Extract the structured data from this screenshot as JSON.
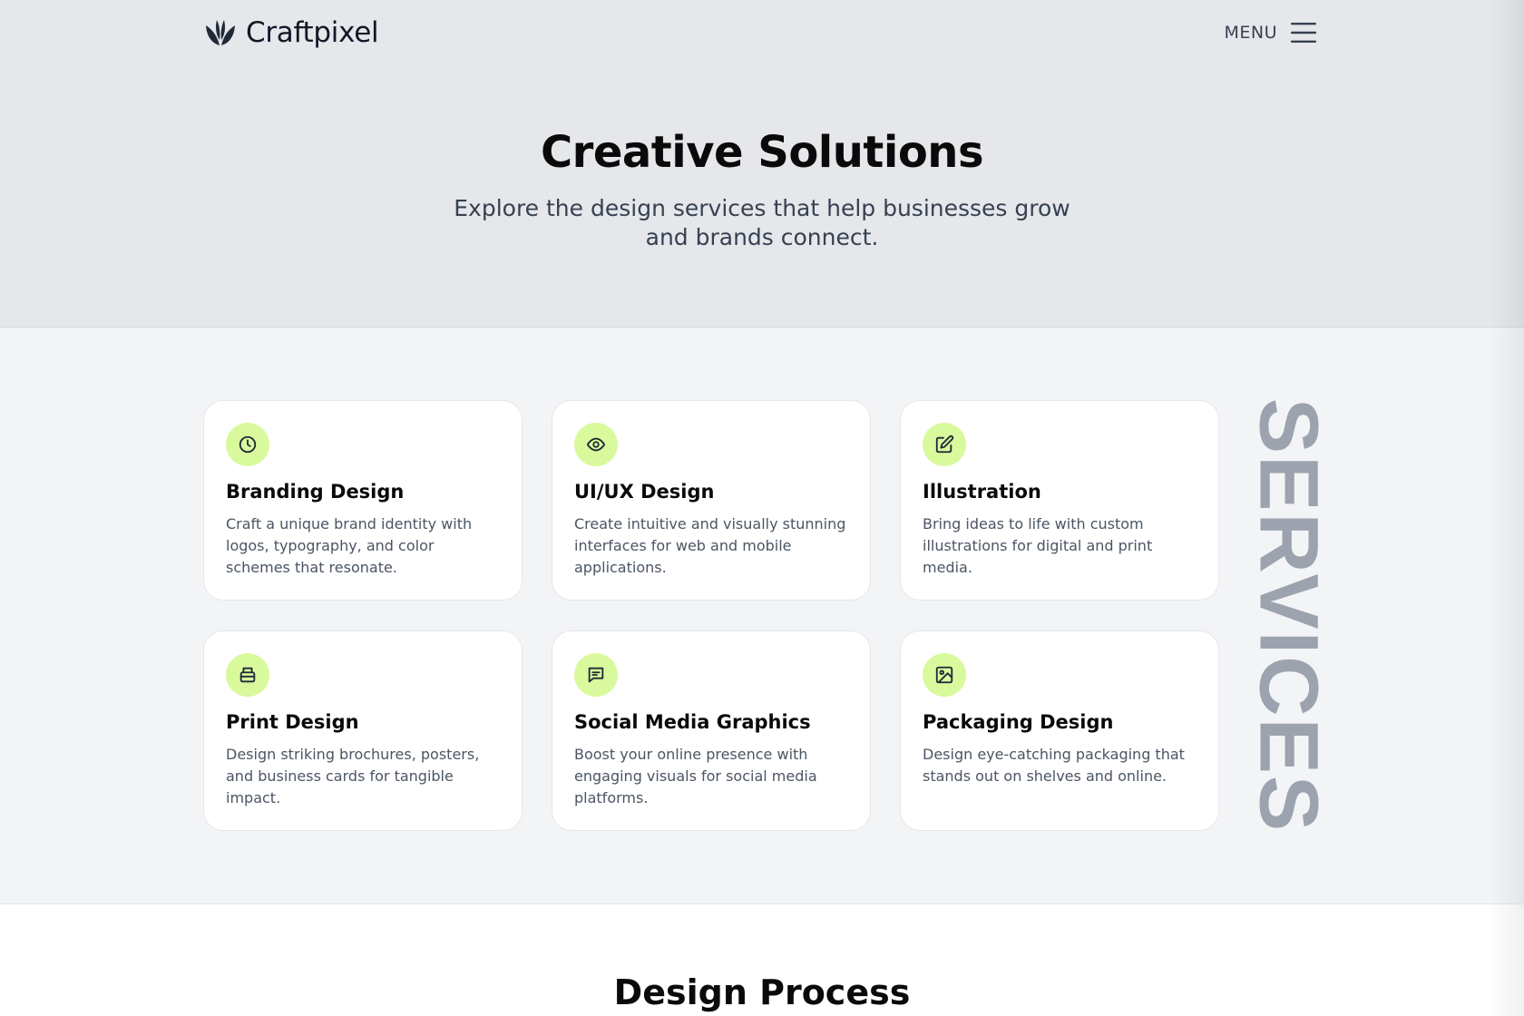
{
  "brand": {
    "name": "Craftpixel",
    "logo_icon": "leaf-wings-icon"
  },
  "nav": {
    "menu_label": "MENU",
    "menu_icon": "hamburger-icon"
  },
  "hero": {
    "title": "Creative Solutions",
    "subtitle": "Explore the design services that help businesses grow and brands connect."
  },
  "services": {
    "side_label": "SERVICES",
    "accent_color": "#d9f99d",
    "items": [
      {
        "title": "Branding Design",
        "description": "Craft a unique brand identity with logos, typography, and color schemes that resonate.",
        "icon": "clock-icon"
      },
      {
        "title": "UI/UX Design",
        "description": "Create intuitive and visually stunning interfaces for web and mobile applications.",
        "icon": "eye-icon"
      },
      {
        "title": "Illustration",
        "description": "Bring ideas to life with custom illustrations for digital and print media.",
        "icon": "pencil-square-icon"
      },
      {
        "title": "Print Design",
        "description": "Design striking brochures, posters, and business cards for tangible impact.",
        "icon": "printer-icon"
      },
      {
        "title": "Social Media Graphics",
        "description": "Boost your online presence with engaging visuals for social media platforms.",
        "icon": "message-icon"
      },
      {
        "title": "Packaging Design",
        "description": "Design eye-catching packaging that stands out on shelves and online.",
        "icon": "image-icon"
      }
    ]
  },
  "process": {
    "title": "Design Process"
  }
}
